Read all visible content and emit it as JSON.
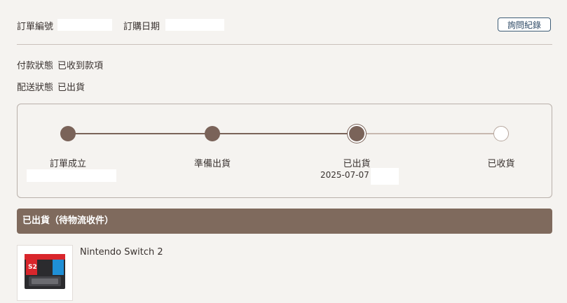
{
  "header": {
    "order_no_label": "訂單編號",
    "order_date_label": "訂購日期",
    "inquiry_button": "詢問紀錄"
  },
  "info": {
    "payment_label": "付款狀態",
    "payment_value": "已收到款項",
    "shipping_label": "配送狀態",
    "shipping_value": "已出貨"
  },
  "progress": {
    "steps": [
      {
        "label": "訂單成立",
        "state": "done"
      },
      {
        "label": "準備出貨",
        "state": "done"
      },
      {
        "label": "已出貨",
        "state": "current",
        "date": "2025-07-07"
      },
      {
        "label": "已收貨",
        "state": "todo"
      }
    ]
  },
  "shipment": {
    "status_title": "已出貨（待物流收件）",
    "product_name": "Nintendo Switch 2"
  },
  "colors": {
    "brown": "#7f6a5d",
    "accent_button": "#3e5c76",
    "track_pending": "#c7b9b0"
  }
}
